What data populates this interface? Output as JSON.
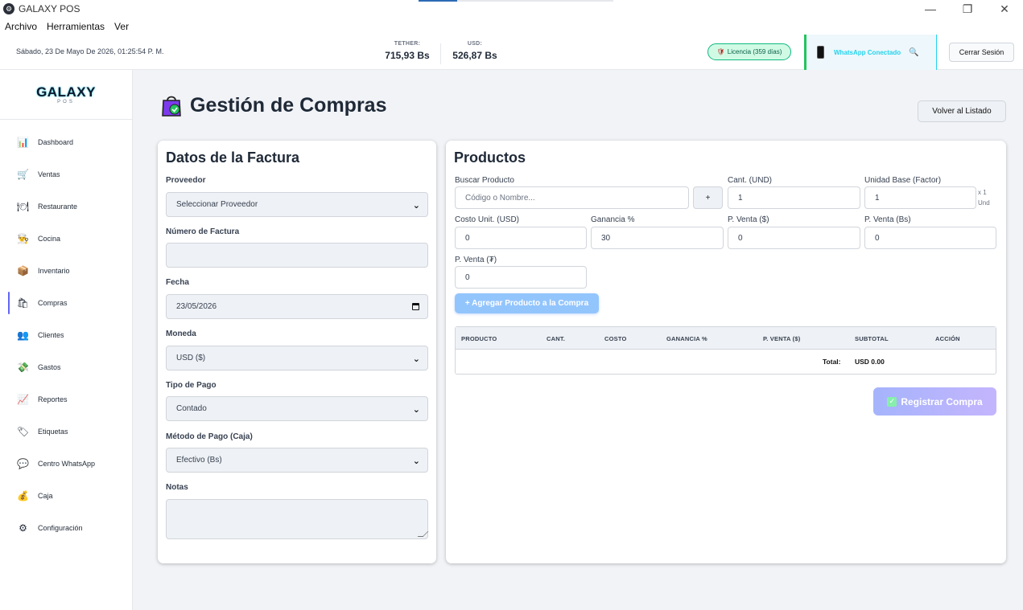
{
  "window": {
    "title": "GALAXY POS",
    "minimize": "—",
    "maximize": "❐",
    "close": "✕"
  },
  "menu": {
    "items": [
      "Archivo",
      "Herramientas",
      "Ver"
    ]
  },
  "infobar": {
    "date": "Sábado, 23 De Mayo De 2026, 01:25:54 P. M.",
    "tether_label": "TETHER:",
    "tether_value": "715,93 Bs",
    "usd_label": "USD:",
    "usd_value": "526,87 Bs",
    "license": "Licencia (359 días)",
    "whatsapp": "WhatsApp Conectado",
    "logout": "Cerrar Sesión"
  },
  "logo": {
    "main": "GALAXY",
    "sub": "POS"
  },
  "sidebar": {
    "items": [
      {
        "label": "Dashboard",
        "icon": "📊"
      },
      {
        "label": "Ventas",
        "icon": "🛒"
      },
      {
        "label": "Restaurante",
        "icon": "🍽"
      },
      {
        "label": "Cocina",
        "icon": "👨‍🍳"
      },
      {
        "label": "Inventario",
        "icon": "📦"
      },
      {
        "label": "Compras",
        "icon": "🛍"
      },
      {
        "label": "Clientes",
        "icon": "👥"
      },
      {
        "label": "Gastos",
        "icon": "💸"
      },
      {
        "label": "Reportes",
        "icon": "📈"
      },
      {
        "label": "Etiquetas",
        "icon": "🏷"
      },
      {
        "label": "Centro WhatsApp",
        "icon": "💬"
      },
      {
        "label": "Caja",
        "icon": "💰"
      },
      {
        "label": "Configuración",
        "icon": "⚙"
      }
    ],
    "active": "Compras"
  },
  "page": {
    "title": "Gestión de Compras",
    "back_button": "Volver al Listado"
  },
  "invoice": {
    "title": "Datos de la Factura",
    "supplier_label": "Proveedor",
    "supplier_value": "Seleccionar Proveedor",
    "number_label": "Número de Factura",
    "number_value": "",
    "date_label": "Fecha",
    "date_value": "23/05/2026",
    "currency_label": "Moneda",
    "currency_value": "USD ($)",
    "payment_type_label": "Tipo de Pago",
    "payment_type_value": "Contado",
    "payment_method_label": "Método de Pago (Caja)",
    "payment_method_value": "Efectivo (Bs)",
    "notes_label": "Notas",
    "notes_value": ""
  },
  "products": {
    "title": "Productos",
    "search_label": "Buscar Producto",
    "search_placeholder": "Código o Nombre...",
    "add_new": "+",
    "qty_label": "Cant. (UND)",
    "qty_value": "1",
    "base_unit_label": "Unidad Base (Factor)",
    "base_unit_value": "1",
    "unit_suffix_1": "x 1",
    "unit_suffix_2": "Und",
    "cost_label": "Costo Unit. (USD)",
    "cost_value": "0",
    "profit_label": "Ganancia %",
    "profit_value": "30",
    "price_usd_label": "P. Venta ($)",
    "price_usd_value": "0",
    "price_bs_label": "P. Venta (Bs)",
    "price_bs_value": "0",
    "price_other_label": "P. Venta (₮)",
    "price_other_value": "0",
    "add_button": "+ Agregar Producto a la Compra",
    "table_headers": [
      "PRODUCTO",
      "CANT.",
      "COSTO",
      "GANANCIA %",
      "P. VENTA ($)",
      "SUBTOTAL",
      "ACCIÓN"
    ],
    "total_label": "Total:",
    "total_value": "USD 0.00",
    "register_button": "Registrar Compra"
  }
}
